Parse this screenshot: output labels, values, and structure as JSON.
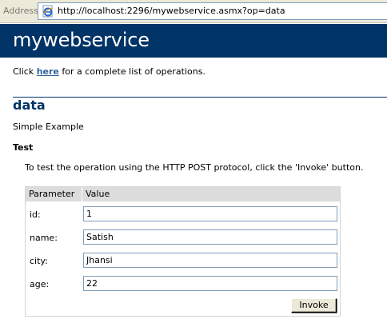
{
  "address_bar": {
    "label": "Address",
    "url": "http://localhost:2296/mywebservice.asmx?op=data"
  },
  "service": {
    "name": "mywebservice"
  },
  "intro": {
    "prefix": "Click ",
    "link": "here",
    "suffix": " for a complete list of operations."
  },
  "operation": {
    "name": "data",
    "description": "Simple Example"
  },
  "test": {
    "heading": "Test",
    "instructions": "To test the operation using the HTTP POST protocol, click the 'Invoke' button."
  },
  "table": {
    "headers": {
      "parameter": "Parameter",
      "value": "Value"
    },
    "rows": [
      {
        "label": "id:",
        "value": "1"
      },
      {
        "label": "name:",
        "value": "Satish"
      },
      {
        "label": "city:",
        "value": "Jhansi"
      },
      {
        "label": "age:",
        "value": "22"
      }
    ],
    "invoke_label": "Invoke"
  },
  "colors": {
    "header_band": "#003366",
    "link": "#336699",
    "table_header": "#dcdcdc"
  },
  "icons": {
    "address_icon": "ie-page-icon"
  }
}
